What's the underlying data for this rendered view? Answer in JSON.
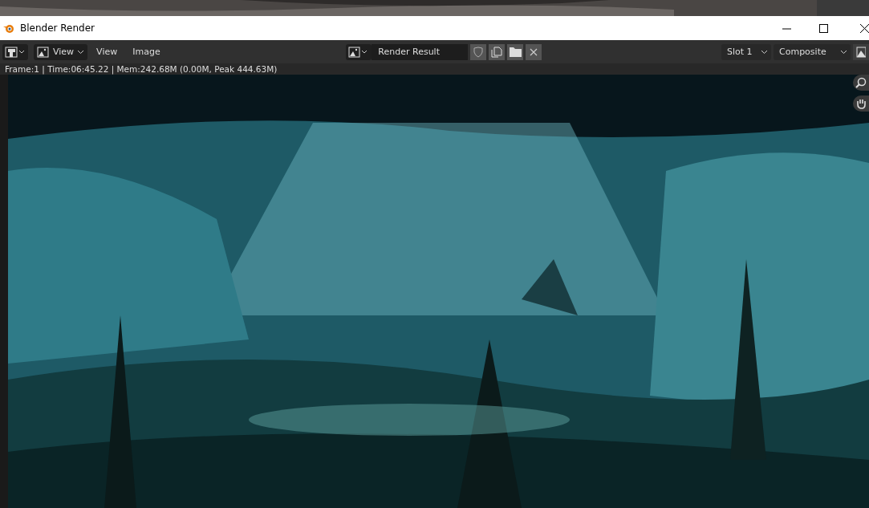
{
  "window": {
    "title": "Blender Render"
  },
  "header": {
    "mode": "View",
    "menus": [
      "View",
      "Image"
    ],
    "image_name": "Render Result",
    "slot": "Slot 1",
    "pass": "Composite"
  },
  "status_bar": "Frame:1 | Time:06:45.22 | Mem:242.68M (0.00M, Peak 444.63M)"
}
